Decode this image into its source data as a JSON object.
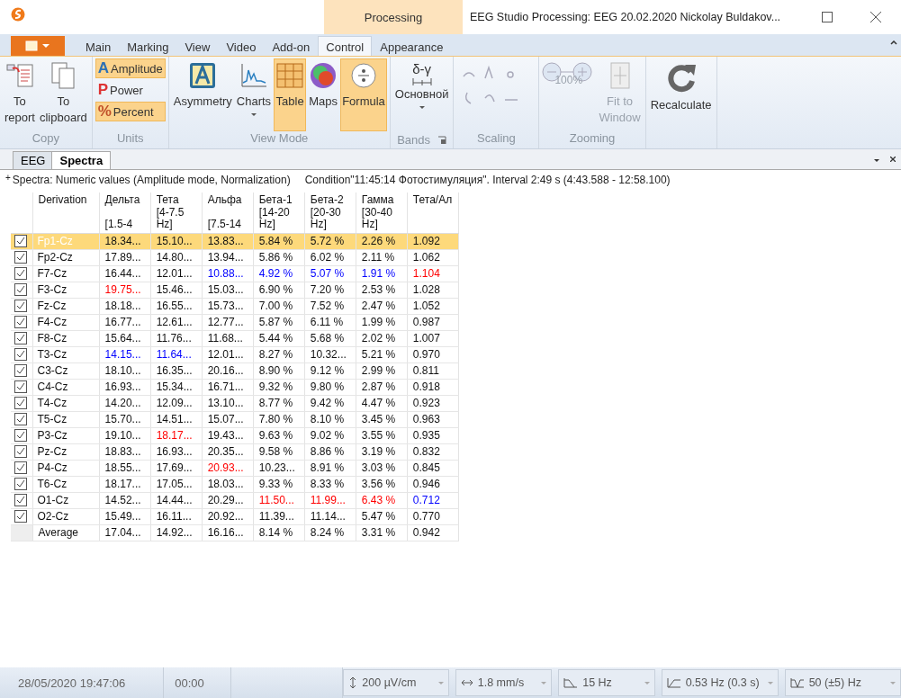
{
  "window": {
    "title": "EEG Studio Processing: EEG 20.02.2020 Nickolay Buldakov...",
    "context_tab": "Processing"
  },
  "menu_tabs": [
    {
      "label": "Main",
      "selected": false
    },
    {
      "label": "Marking",
      "selected": false
    },
    {
      "label": "View",
      "selected": false
    },
    {
      "label": "Video",
      "selected": false
    },
    {
      "label": "Add-on",
      "selected": false
    },
    {
      "label": "Control",
      "selected": true
    },
    {
      "label": "Appearance",
      "selected": false
    }
  ],
  "ribbon": {
    "copy": {
      "label": "Copy",
      "buttons": [
        {
          "label": "To report"
        },
        {
          "label": "To clipboard"
        }
      ]
    },
    "units": {
      "label": "Units",
      "options": [
        {
          "label": "Amplitude",
          "icon": "A",
          "selected": true
        },
        {
          "label": "Power",
          "icon": "P",
          "selected": false
        },
        {
          "label": "Percent",
          "icon": "%",
          "selected": true
        }
      ]
    },
    "view_mode": {
      "label": "View Mode",
      "buttons": [
        {
          "label": "Asymmetry",
          "selected": false,
          "dropdown": false
        },
        {
          "label": "Charts",
          "selected": false,
          "dropdown": true
        },
        {
          "label": "Table",
          "selected": true,
          "dropdown": false
        },
        {
          "label": "Maps",
          "selected": false,
          "dropdown": false
        },
        {
          "label": "Formula",
          "selected": true,
          "dropdown": false
        }
      ]
    },
    "bands": {
      "label": "Bands",
      "symbol": "δ-γ",
      "button": "Основной"
    },
    "scaling": {
      "label": "Scaling",
      "disabled": true
    },
    "zooming": {
      "label": "Zooming",
      "zoom_value": "100%",
      "fit": "Fit to Window",
      "disabled": true
    },
    "recalculate": {
      "label": "Recalculate"
    }
  },
  "doc_tabs": [
    {
      "label": "EEG",
      "selected": false
    },
    {
      "label": "Spectra",
      "selected": true
    }
  ],
  "info": {
    "mark": "+",
    "text": "Spectra: Numeric values (Amplitude mode, Normalization)",
    "condition": "Condition\"11:45:14 Фотостимуляция\". Interval 2:49 s (4:43.588 - 12:58.100)"
  },
  "table": {
    "columns": [
      {
        "name": "Derivation"
      },
      {
        "name": "Дельта",
        "range": "[1.5-4"
      },
      {
        "name": "Тета",
        "range": "[4-7.5 Hz]"
      },
      {
        "name": "Альфа",
        "range": "[7.5-14"
      },
      {
        "name": "Бета-1",
        "range": "[14-20 Hz]"
      },
      {
        "name": "Бета-2",
        "range": "[20-30 Hz]"
      },
      {
        "name": "Гамма",
        "range": "[30-40 Hz]"
      },
      {
        "name": "Тета/Ал"
      }
    ],
    "rows": [
      {
        "checked": true,
        "selected": true,
        "cells": [
          "Fp1-Cz",
          "18.34...",
          "15.10...",
          "13.83...",
          "5.84 %",
          "5.72 %",
          "2.26 %",
          "1.092"
        ]
      },
      {
        "checked": true,
        "selected": false,
        "cells": [
          "Fp2-Cz",
          "17.89...",
          "14.80...",
          "13.94...",
          "5.86 %",
          "6.02 %",
          "2.11 %",
          "1.062"
        ]
      },
      {
        "checked": true,
        "selected": false,
        "cells": [
          "F7-Cz",
          "16.44...",
          "12.01...",
          {
            "text": "10.88...",
            "color": "#0000ff"
          },
          {
            "text": "4.92 %",
            "color": "#0000ff"
          },
          {
            "text": "5.07 %",
            "color": "#0000ff"
          },
          {
            "text": "1.91 %",
            "color": "#0000ff"
          },
          {
            "text": "1.104",
            "color": "#ff0000"
          }
        ]
      },
      {
        "checked": true,
        "selected": false,
        "cells": [
          "F3-Cz",
          {
            "text": "19.75...",
            "color": "#ff0000"
          },
          "15.46...",
          "15.03...",
          "6.90 %",
          "7.20 %",
          "2.53 %",
          "1.028"
        ]
      },
      {
        "checked": true,
        "selected": false,
        "cells": [
          "Fz-Cz",
          "18.18...",
          "16.55...",
          "15.73...",
          "7.00 %",
          "7.52 %",
          "2.47 %",
          "1.052"
        ]
      },
      {
        "checked": true,
        "selected": false,
        "cells": [
          "F4-Cz",
          "16.77...",
          "12.61...",
          "12.77...",
          "5.87 %",
          "6.11 %",
          "1.99 %",
          "0.987"
        ]
      },
      {
        "checked": true,
        "selected": false,
        "cells": [
          "F8-Cz",
          "15.64...",
          "11.76...",
          "11.68...",
          "5.44 %",
          "5.68 %",
          "2.02 %",
          "1.007"
        ]
      },
      {
        "checked": true,
        "selected": false,
        "cells": [
          "T3-Cz",
          {
            "text": "14.15...",
            "color": "#0000ff"
          },
          {
            "text": "11.64...",
            "color": "#0000ff"
          },
          "12.01...",
          "8.27 %",
          "10.32...",
          "5.21 %",
          "0.970"
        ]
      },
      {
        "checked": true,
        "selected": false,
        "cells": [
          "C3-Cz",
          "18.10...",
          "16.35...",
          "20.16...",
          "8.90 %",
          "9.12 %",
          "2.99 %",
          "0.811"
        ]
      },
      {
        "checked": true,
        "selected": false,
        "cells": [
          "C4-Cz",
          "16.93...",
          "15.34...",
          "16.71...",
          "9.32 %",
          "9.80 %",
          "2.87 %",
          "0.918"
        ]
      },
      {
        "checked": true,
        "selected": false,
        "cells": [
          "T4-Cz",
          "14.20...",
          "12.09...",
          "13.10...",
          "8.77 %",
          "9.42 %",
          "4.47 %",
          "0.923"
        ]
      },
      {
        "checked": true,
        "selected": false,
        "cells": [
          "T5-Cz",
          "15.70...",
          "14.51...",
          "15.07...",
          "7.80 %",
          "8.10 %",
          "3.45 %",
          "0.963"
        ]
      },
      {
        "checked": true,
        "selected": false,
        "cells": [
          "P3-Cz",
          "19.10...",
          {
            "text": "18.17...",
            "color": "#ff0000"
          },
          "19.43...",
          "9.63 %",
          "9.02 %",
          "3.55 %",
          "0.935"
        ]
      },
      {
        "checked": true,
        "selected": false,
        "cells": [
          "Pz-Cz",
          "18.83...",
          "16.93...",
          "20.35...",
          "9.58 %",
          "8.86 %",
          "3.19 %",
          "0.832"
        ]
      },
      {
        "checked": true,
        "selected": false,
        "cells": [
          "P4-Cz",
          "18.55...",
          "17.69...",
          {
            "text": "20.93...",
            "color": "#ff0000"
          },
          "10.23...",
          "8.91 %",
          "3.03 %",
          "0.845"
        ]
      },
      {
        "checked": true,
        "selected": false,
        "cells": [
          "T6-Cz",
          "18.17...",
          "17.05...",
          "18.03...",
          "9.33 %",
          "8.33 %",
          "3.56 %",
          "0.946"
        ]
      },
      {
        "checked": true,
        "selected": false,
        "cells": [
          "O1-Cz",
          "14.52...",
          "14.44...",
          "20.29...",
          {
            "text": "11.50...",
            "color": "#ff0000"
          },
          {
            "text": "11.99...",
            "color": "#ff0000"
          },
          {
            "text": "6.43 %",
            "color": "#ff0000"
          },
          {
            "text": "0.712",
            "color": "#0000ff"
          }
        ]
      },
      {
        "checked": true,
        "selected": false,
        "cells": [
          "O2-Cz",
          "15.49...",
          "16.11...",
          "20.92...",
          "11.39...",
          "11.14...",
          "5.47 %",
          "0.770"
        ]
      }
    ],
    "average": [
      "Average",
      "17.04...",
      "14.92...",
      "16.16...",
      "8.14 %",
      "8.24 %",
      "3.31 %",
      "0.942"
    ]
  },
  "status_bar": {
    "date": "28/05/2020  19:47:06",
    "time": "00:00",
    "controls": [
      {
        "kind": "sensitivity",
        "value": "200 µV/cm"
      },
      {
        "kind": "speed",
        "value": "1.8 mm/s"
      },
      {
        "kind": "lowpass",
        "value": "15 Hz"
      },
      {
        "kind": "highpass",
        "value": "0.53 Hz (0.3 s)"
      },
      {
        "kind": "notch",
        "value": "50 (±5) Hz"
      }
    ]
  }
}
